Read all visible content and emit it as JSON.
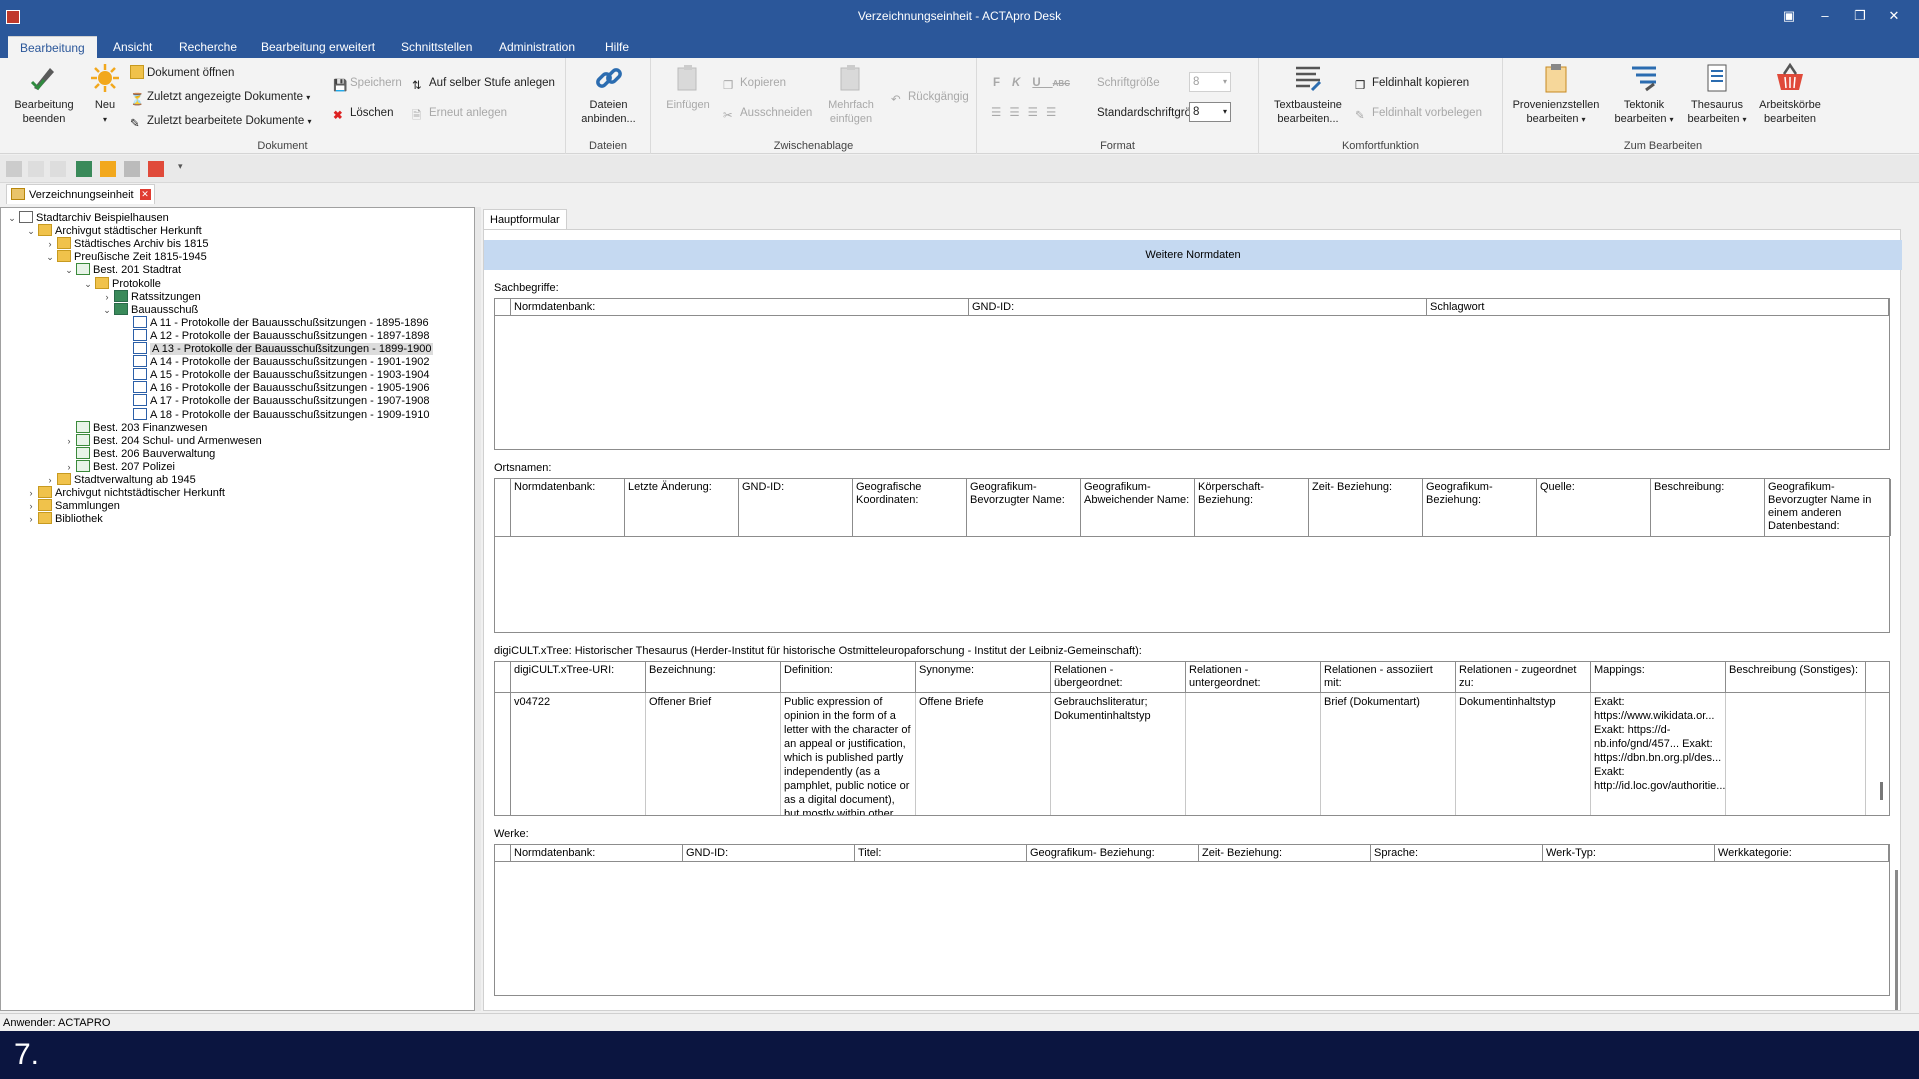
{
  "window": {
    "title": "Verzeichnungseinheit - ACTApro Desk"
  },
  "ribbon_tabs": [
    "Bearbeitung",
    "Ansicht",
    "Recherche",
    "Bearbeitung erweitert",
    "Schnittstellen",
    "Administration",
    "Hilfe"
  ],
  "ribbon": {
    "bearbeitung_beenden": "Bearbeitung beenden",
    "neu": "Neu",
    "dokument_oeffnen": "Dokument öffnen",
    "zuletzt_angezeigt": "Zuletzt angezeigte Dokumente",
    "zuletzt_bearbeitet": "Zuletzt bearbeitete Dokumente",
    "speichern": "Speichern",
    "auf_selber_stufe": "Auf selber Stufe anlegen",
    "loeschen": "Löschen",
    "erneut_anlegen": "Erneut anlegen",
    "group_dokument": "Dokument",
    "dateien_anbinden": "Dateien anbinden...",
    "group_dateien": "Dateien",
    "einfuegen": "Einfügen",
    "kopieren": "Kopieren",
    "ausschneiden": "Ausschneiden",
    "mehrfach_einfuegen": "Mehrfach einfügen",
    "rueckgaengig": "Rückgängig",
    "group_zwischenablage": "Zwischenablage",
    "schriftgroesse": "Schriftgröße",
    "schriftgroesse_val": "8",
    "standardschriftgroesse": "Standardschriftgröße",
    "standardschriftgroesse_val": "8",
    "group_format": "Format",
    "textbausteine": "Textbausteine bearbeiten...",
    "feldinhalt_kopieren": "Feldinhalt kopieren",
    "feldinhalt_vorbelegen": "Feldinhalt vorbelegen",
    "group_komfort": "Komfortfunktion",
    "provenienzstellen": "Provenienzstellen bearbeiten",
    "tektonik": "Tektonik bearbeiten",
    "thesaurus": "Thesaurus bearbeiten",
    "arbeitskoerbe": "Arbeitskörbe bearbeiten",
    "group_zum_bearbeiten": "Zum Bearbeiten"
  },
  "doc_tab": "Verzeichnungseinheit",
  "tree": [
    {
      "label": "Stadtarchiv Beispielhausen",
      "exp": "−",
      "icon": "arch"
    },
    {
      "label": "Archivgut städtischer Herkunft",
      "exp": "−",
      "icon": "folder"
    },
    {
      "label": "Städtisches Archiv bis 1815",
      "exp": "›",
      "icon": "folder"
    },
    {
      "label": "Preußische Zeit 1815-1945",
      "exp": "−",
      "icon": "folder"
    },
    {
      "label": "Best. 201 Stadtrat",
      "exp": "−",
      "icon": "book"
    },
    {
      "label": "Protokolle",
      "exp": "−",
      "icon": "folder"
    },
    {
      "label": "Ratssitzungen",
      "exp": "›",
      "icon": "series"
    },
    {
      "label": "Bauausschuß",
      "exp": "−",
      "icon": "series"
    },
    {
      "label": "A 11 - Protokolle der Bauausschußsitzungen - 1895-1896",
      "exp": "",
      "icon": "doc"
    },
    {
      "label": "A 12 - Protokolle der Bauausschußsitzungen - 1897-1898",
      "exp": "",
      "icon": "doc"
    },
    {
      "label": "A 13 - Protokolle der Bauausschußsitzungen - 1899-1900",
      "exp": "",
      "icon": "doc"
    },
    {
      "label": "A 14 - Protokolle der Bauausschußsitzungen - 1901-1902",
      "exp": "",
      "icon": "doc"
    },
    {
      "label": "A 15 - Protokolle der Bauausschußsitzungen - 1903-1904",
      "exp": "",
      "icon": "doc"
    },
    {
      "label": "A 16 - Protokolle der Bauausschußsitzungen - 1905-1906",
      "exp": "",
      "icon": "doc"
    },
    {
      "label": "A 17 - Protokolle der Bauausschußsitzungen - 1907-1908",
      "exp": "",
      "icon": "doc"
    },
    {
      "label": "A 18 - Protokolle der Bauausschußsitzungen - 1909-1910",
      "exp": "",
      "icon": "doc"
    },
    {
      "label": "Best. 203 Finanzwesen",
      "exp": "",
      "icon": "book"
    },
    {
      "label": "Best. 204 Schul- und Armenwesen",
      "exp": "›",
      "icon": "book"
    },
    {
      "label": "Best. 206 Bauverwaltung",
      "exp": "",
      "icon": "book"
    },
    {
      "label": "Best. 207 Polizei",
      "exp": "›",
      "icon": "book"
    },
    {
      "label": "Stadtverwaltung ab 1945",
      "exp": "›",
      "icon": "folder"
    },
    {
      "label": "Archivgut nichtstädtischer Herkunft",
      "exp": "›",
      "icon": "folder"
    },
    {
      "label": "Sammlungen",
      "exp": "›",
      "icon": "folder"
    },
    {
      "label": "Bibliothek",
      "exp": "›",
      "icon": "folder"
    }
  ],
  "form": {
    "tab": "Hauptformular",
    "banner": "Weitere Normdaten",
    "sachbegriffe": {
      "label": "Sachbegriffe:",
      "cols": [
        "Normdatenbank:",
        "GND-ID:",
        "Schlagwort"
      ]
    },
    "ortsnamen": {
      "label": "Ortsnamen:",
      "cols": [
        "Normdatenbank:",
        "Letzte Änderung:",
        "GND-ID:",
        "Geografische Koordinaten:",
        "Geografikum-Bevorzugter Name:",
        "Geografikum-Abweichender Name:",
        "Körperschaft-Beziehung:",
        "Zeit- Beziehung:",
        "Geografikum-Beziehung:",
        "Quelle:",
        "Beschreibung:",
        "Geografikum-Bevorzugter Name in einem anderen Datenbestand:"
      ]
    },
    "digicult": {
      "label": "digiCULT.xTree: Historischer Thesaurus (Herder-Institut für historische Ostmitteleuropaforschung - Institut der Leibniz-Gemeinschaft):",
      "cols": [
        "digiCULT.xTree-URI:",
        "Bezeichnung:",
        "Definition:",
        "Synonyme:",
        "Relationen - übergeordnet:",
        "Relationen - untergeordnet:",
        "Relationen - assoziiert mit:",
        "Relationen - zugeordnet zu:",
        "Mappings:",
        "Beschreibung (Sonstiges):"
      ],
      "row": [
        "v04722",
        "Offener Brief",
        "Public expression of opinion in the form of a letter with the character of an appeal or justification, which is published partly independently (as a pamphlet, public notice or as a digital document), but mostly within other, analog",
        "Offene Briefe",
        "Gebrauchsliteratur; Dokumentinhaltstyp",
        "",
        "Brief (Dokumentart)",
        "Dokumentinhaltstyp",
        "Exakt: https://www.wikidata.or... Exakt: https://d-nb.info/gnd/457... Exakt: https://dbn.bn.org.pl/des... Exakt: http://id.loc.gov/authoritie...",
        ""
      ]
    },
    "werke": {
      "label": "Werke:",
      "cols": [
        "Normdatenbank:",
        "GND-ID:",
        "Titel:",
        "Geografikum- Beziehung:",
        "Zeit- Beziehung:",
        "Sprache:",
        "Werk-Typ:",
        "Werkkategorie:"
      ]
    }
  },
  "status": "Anwender: ACTAPRO",
  "caption": "7."
}
